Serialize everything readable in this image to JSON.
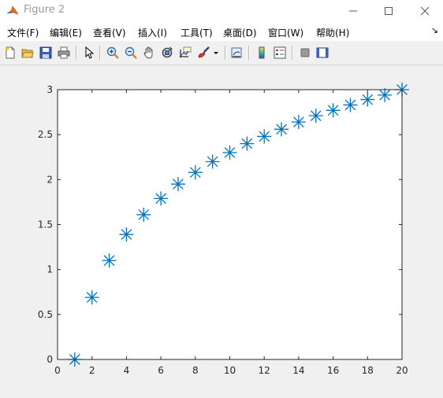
{
  "window": {
    "title": "Figure 2"
  },
  "menu": {
    "items": [
      "文件(F)",
      "编辑(E)",
      "查看(V)",
      "插入(I)",
      "工具(T)",
      "桌面(D)",
      "窗口(W)",
      "帮助(H)"
    ]
  },
  "toolbar": {
    "buttons": [
      "new-figure-icon",
      "open-file-icon",
      "save-icon",
      "print-icon",
      "pointer-icon",
      "zoom-in-icon",
      "zoom-out-icon",
      "pan-icon",
      "rotate-3d-icon",
      "data-cursor-icon",
      "brush-icon",
      "link-plot-icon",
      "colorbar-icon",
      "legend-icon",
      "hide-plot-tools-icon",
      "show-plot-tools-icon"
    ]
  },
  "colors": {
    "series": "#0072bd",
    "axes": "#262626",
    "figure_bg": "#f0f0f0"
  },
  "chart_data": {
    "type": "scatter",
    "marker": "asterisk",
    "title": "",
    "xlabel": "",
    "ylabel": "",
    "xlim": [
      0,
      20
    ],
    "ylim": [
      0,
      3
    ],
    "xticks": [
      "0",
      "2",
      "4",
      "6",
      "8",
      "10",
      "12",
      "14",
      "16",
      "18",
      "20"
    ],
    "yticks": [
      "0",
      "0.5",
      "1",
      "1.5",
      "2",
      "2.5",
      "3"
    ],
    "series": [
      {
        "x": [
          1,
          2,
          3,
          4,
          5,
          6,
          7,
          8,
          9,
          10,
          11,
          12,
          13,
          14,
          15,
          16,
          17,
          18,
          19,
          20
        ],
        "y": [
          0,
          0.69,
          1.1,
          1.39,
          1.61,
          1.79,
          1.95,
          2.08,
          2.2,
          2.3,
          2.4,
          2.48,
          2.56,
          2.64,
          2.71,
          2.77,
          2.83,
          2.89,
          2.94,
          3.0
        ]
      }
    ],
    "grid": false
  }
}
